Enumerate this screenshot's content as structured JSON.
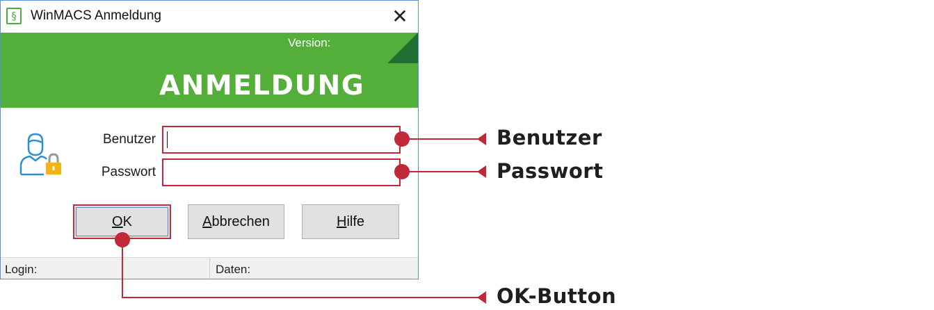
{
  "window": {
    "title": "WinMACS Anmeldung",
    "app_icon_glyph": "§",
    "close_glyph": "✕"
  },
  "banner": {
    "version_label": "Version:",
    "heading": "ANMELDUNG"
  },
  "form": {
    "user_label": "Benutzer",
    "user_value": "",
    "password_label": "Passwort",
    "password_value": ""
  },
  "buttons": {
    "ok": {
      "mnemonic": "O",
      "rest": "K"
    },
    "cancel": {
      "mnemonic": "A",
      "rest": "bbrechen"
    },
    "help": {
      "mnemonic": "H",
      "rest": "ilfe"
    }
  },
  "statusbar": {
    "login": "Login:",
    "daten": "Daten:"
  },
  "annotations": {
    "user": "Benutzer",
    "password": "Passwort",
    "ok": "OK-Button"
  },
  "colors": {
    "banner_green": "#54ae3a",
    "corner_dark_green": "#1f6f32",
    "callout_red": "#c0283a",
    "icon_blue": "#2e8fd0",
    "lock_yellow": "#f2b418"
  },
  "icons": [
    "app-icon",
    "close-icon",
    "user-lock-icon"
  ]
}
